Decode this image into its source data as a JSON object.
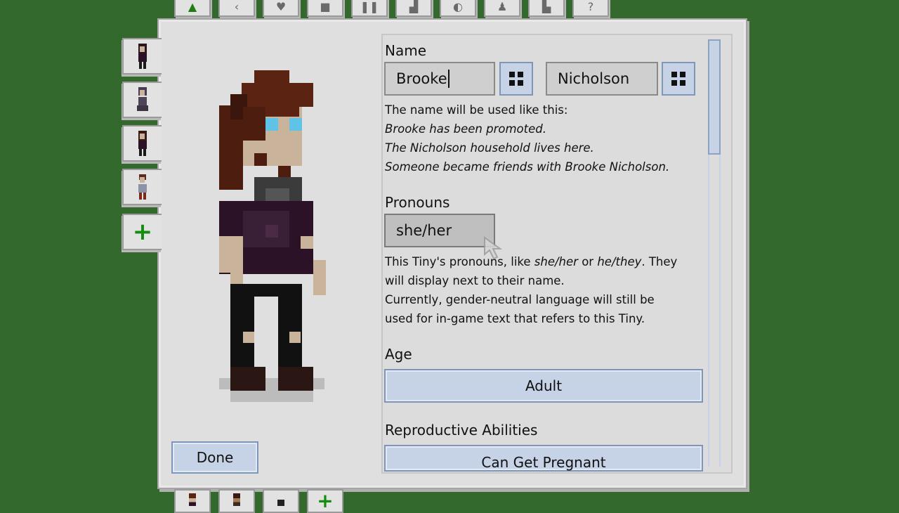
{
  "top_tabs": [
    {
      "icon": "tree-icon"
    },
    {
      "icon": "arrow-icon"
    },
    {
      "icon": "heart-icon"
    },
    {
      "icon": "shirt-icon"
    },
    {
      "icon": "pause-icon"
    },
    {
      "icon": "stats-icon"
    },
    {
      "icon": "paint-icon"
    },
    {
      "icon": "tiny-icon"
    },
    {
      "icon": "building-icon"
    },
    {
      "icon": "question-icon",
      "glyph": "?"
    }
  ],
  "side_tabs": [
    {
      "icon": "tiny-portrait-icon"
    },
    {
      "icon": "tiny-portrait-icon"
    },
    {
      "icon": "tiny-portrait-icon"
    },
    {
      "icon": "tiny-portrait-icon"
    },
    {
      "icon": "plus-icon",
      "glyph": "+"
    }
  ],
  "bottom_tabs": [
    {
      "icon": "tiny-portrait-icon"
    },
    {
      "icon": "tiny-portrait-icon"
    },
    {
      "icon": "tiny-portrait-icon"
    },
    {
      "icon": "plus-icon",
      "glyph": "+"
    }
  ],
  "done_label": "Done",
  "name": {
    "label": "Name",
    "first": "Brooke",
    "last": "Nicholson",
    "usage_intro": "The name will be used like this:",
    "example_1": "Brooke has been promoted.",
    "example_2": "The Nicholson household lives here.",
    "example_3": "Someone became friends with Brooke Nicholson."
  },
  "pronouns": {
    "label": "Pronouns",
    "value": "she/her",
    "help_1a": "This Tiny's pronouns, like ",
    "help_1b": "she/her",
    "help_1c": " or ",
    "help_1d": "he/they",
    "help_1e": ". They",
    "help_2": "will display next to their name.",
    "help_3": "Currently, gender-neutral language will still be",
    "help_4": "used for in-game text that refers to this Tiny."
  },
  "age": {
    "label": "Age",
    "value": "Adult"
  },
  "reproductive": {
    "label": "Reproductive Abilities",
    "value": "Can Get Pregnant"
  },
  "colors": {
    "background": "#33692c",
    "panel": "#dfdfdf",
    "button": "#c6d3e7",
    "hair": "#5a2312",
    "skin": "#c9b49b",
    "eyes": "#5ec3e6",
    "shirt": "#2c1227"
  }
}
